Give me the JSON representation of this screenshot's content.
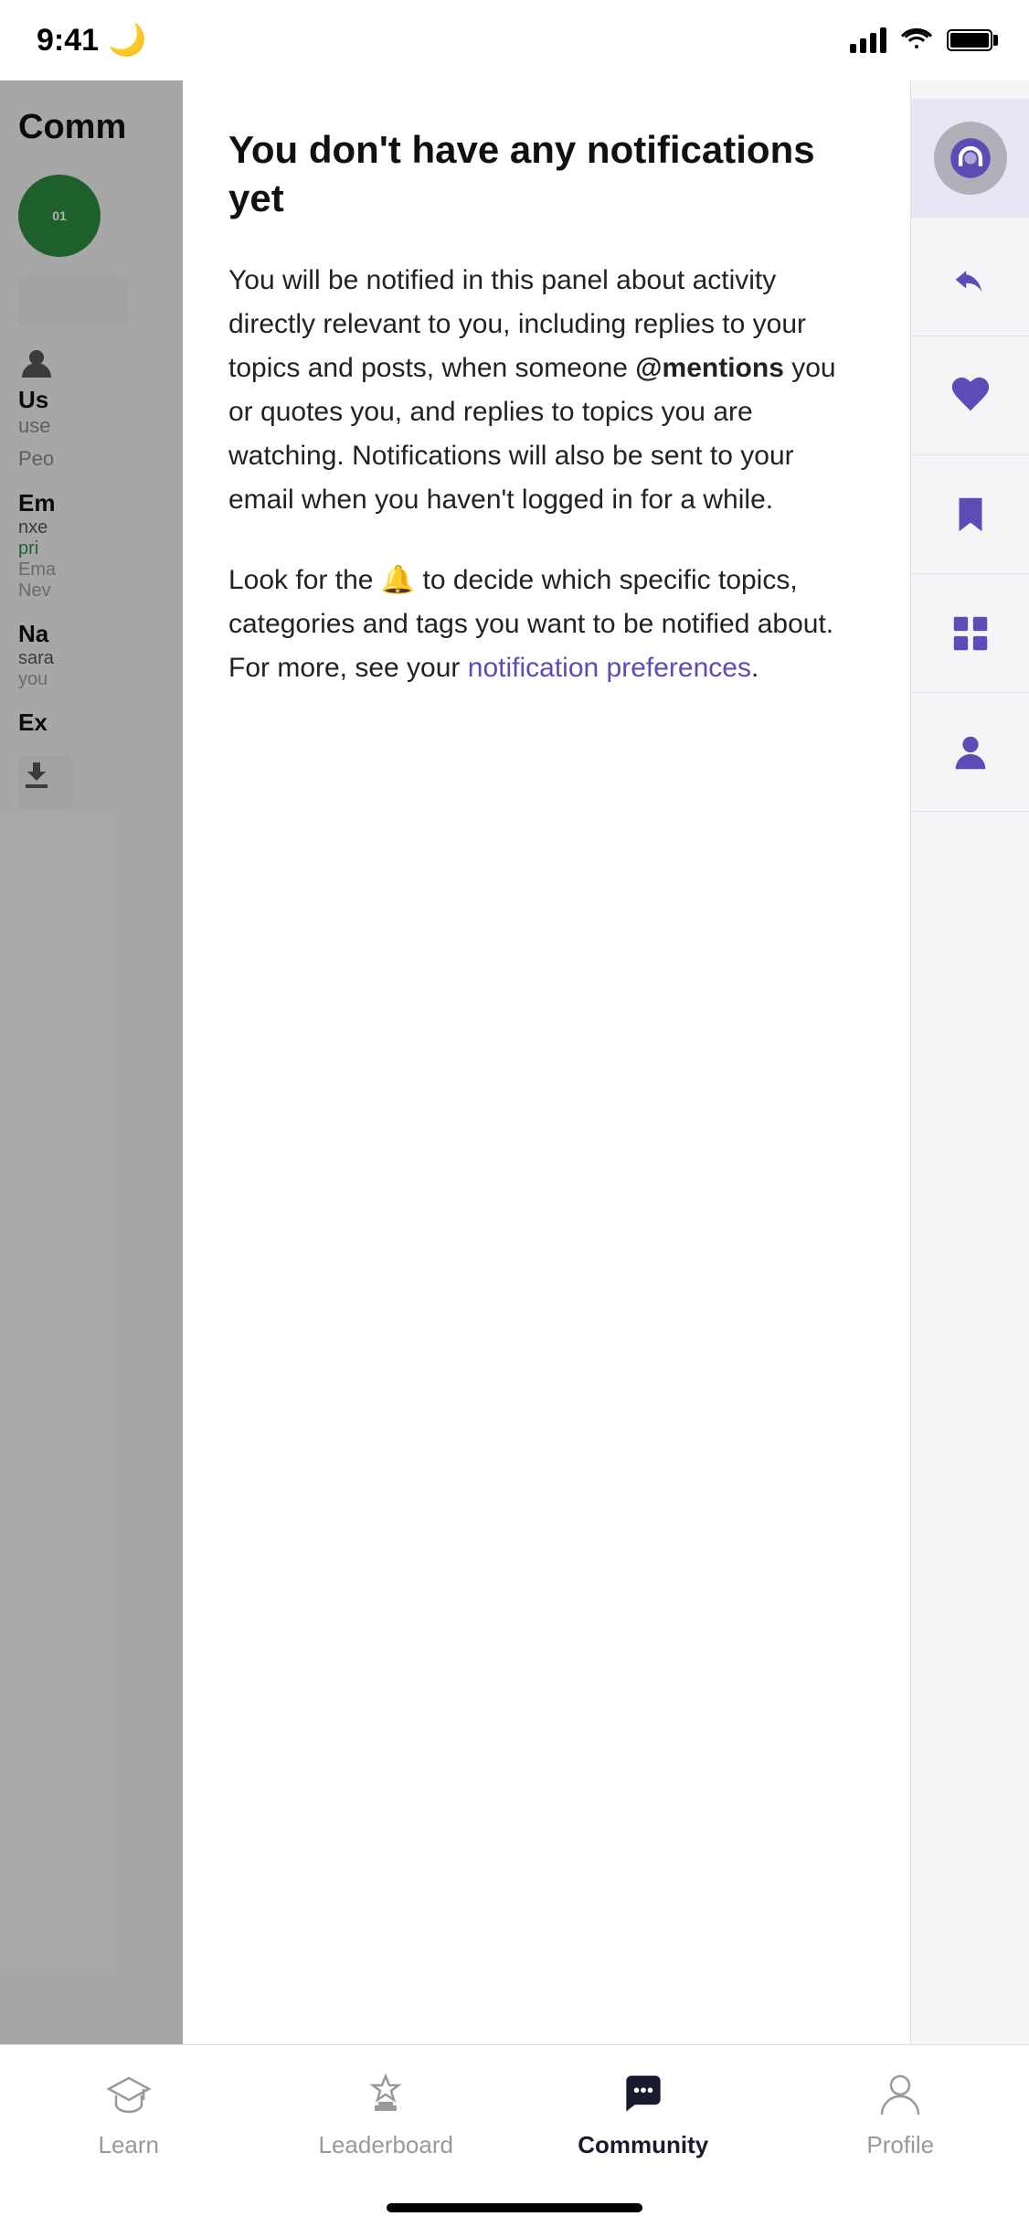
{
  "statusBar": {
    "time": "9:41",
    "moonIcon": "🌙"
  },
  "background": {
    "title": "Comm",
    "userSection": {
      "label": "Us",
      "sub": "use",
      "people": "Peo"
    },
    "emailSection": {
      "label": "Em",
      "value": "nxe",
      "link": "pri",
      "hint1": "Ema",
      "hint2": "Nev"
    },
    "nameSection": {
      "label": "Na",
      "value": "sara",
      "hint": "you"
    },
    "exportSection": {
      "label": "Ex"
    }
  },
  "notificationPanel": {
    "title": "You don't have any notifications yet",
    "body1": "You will be notified in this panel about activity directly relevant to you, including replies to your topics and posts, when someone",
    "mention": "@mentions",
    "body1cont": "you or quotes you, and replies to topics you are watching. Notifications will also be sent to your email when you haven't logged in for a while.",
    "body2prefix": "Look for the",
    "body2suffix": "to decide which specific topics, categories and tags you want to be notified about. For more, see your",
    "linkText": "notification preferences",
    "period": "."
  },
  "rightSidebar": {
    "icons": [
      {
        "name": "bell-icon",
        "active": true
      },
      {
        "name": "reply-icon",
        "active": false
      },
      {
        "name": "heart-icon",
        "active": false
      },
      {
        "name": "bookmark-icon",
        "active": false
      },
      {
        "name": "grid-icon",
        "active": false
      },
      {
        "name": "profile-icon",
        "active": false
      }
    ]
  },
  "tabBar": {
    "tabs": [
      {
        "id": "learn",
        "label": "Learn",
        "active": false
      },
      {
        "id": "leaderboard",
        "label": "Leaderboard",
        "active": false
      },
      {
        "id": "community",
        "label": "Community",
        "active": true
      },
      {
        "id": "profile",
        "label": "Profile",
        "active": false
      }
    ]
  }
}
